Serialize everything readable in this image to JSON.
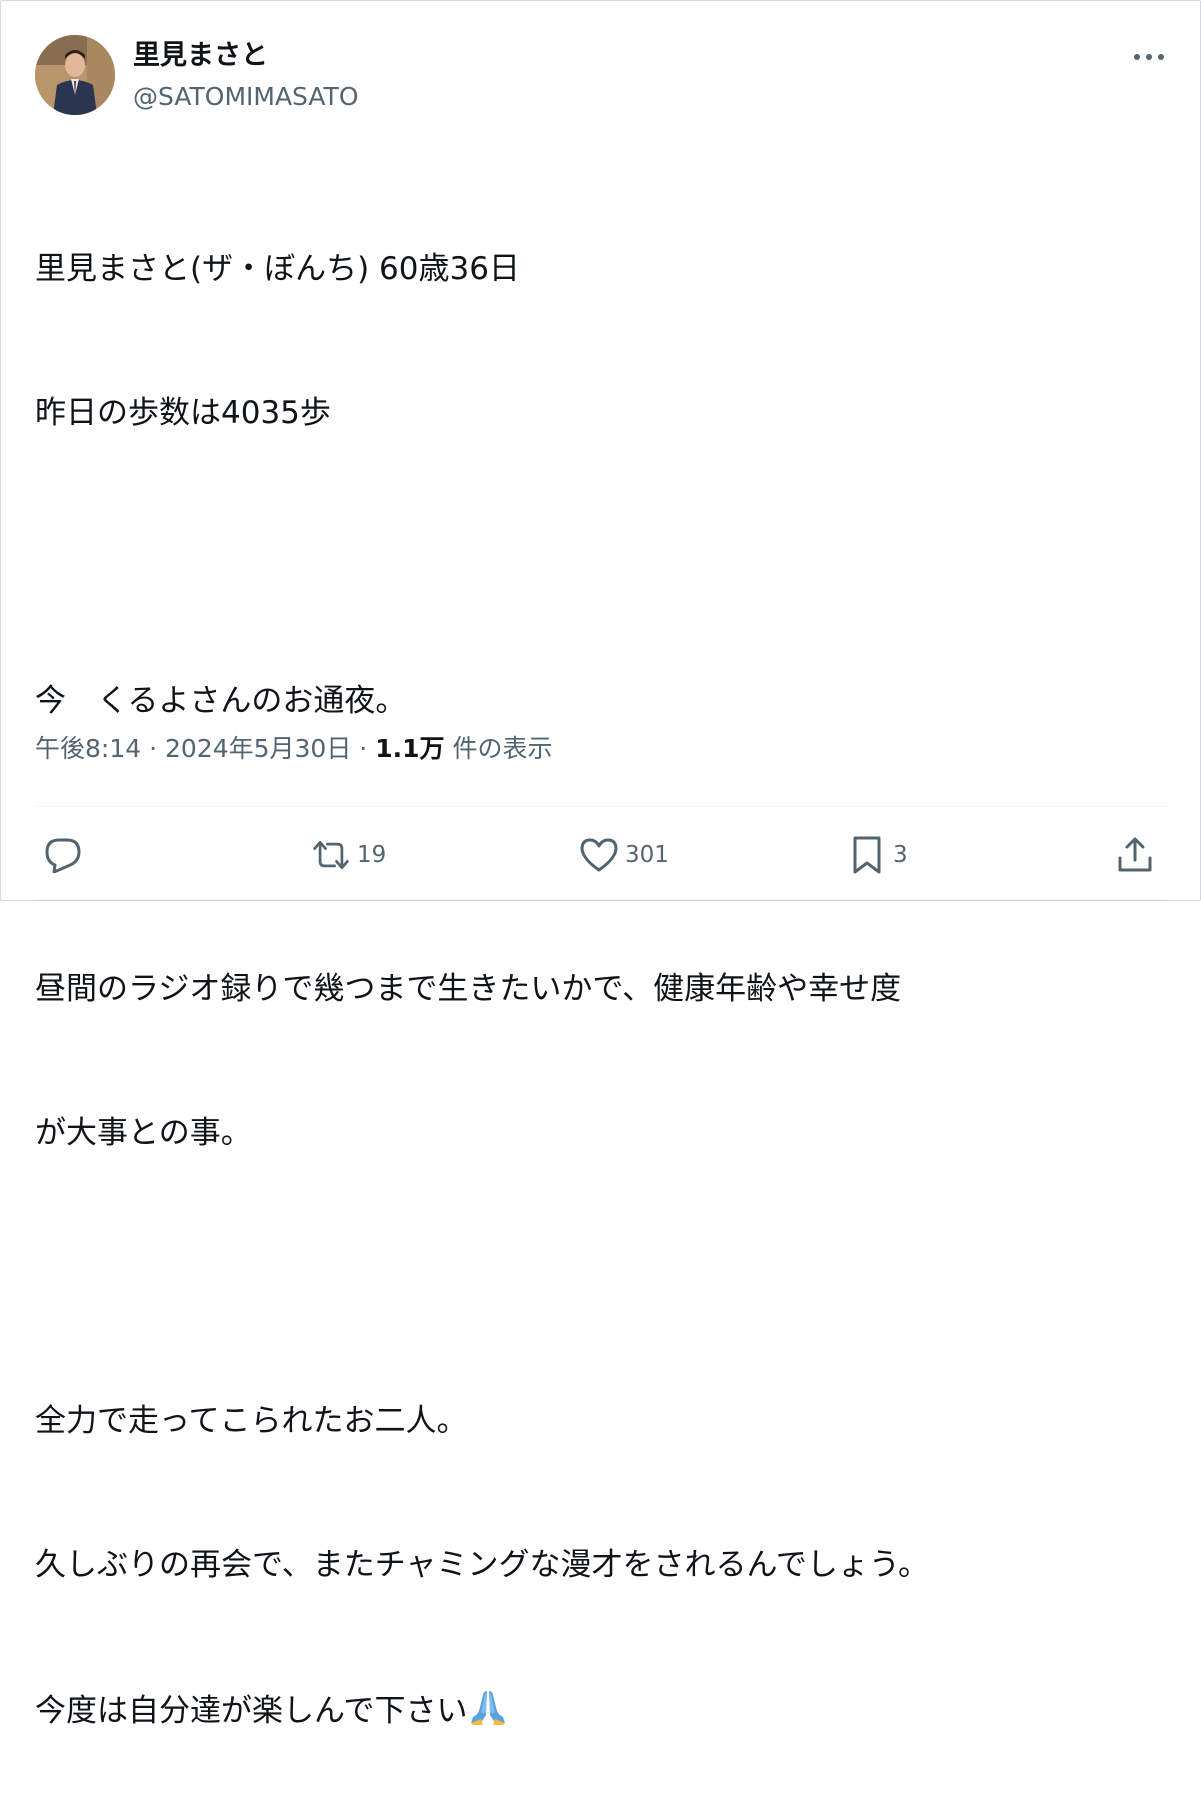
{
  "author": {
    "display_name": "里見まさと",
    "handle": "@SATOMIMASATO",
    "avatar_icon": "avatar-photo"
  },
  "post": {
    "lines": [
      "里見まさと(ザ・ぼんち) 60歳36日",
      "昨日の歩数は4035歩",
      "",
      "今　くるよさんのお通夜。",
      "",
      "昼間のラジオ録りで幾つまで生きたいかで、健康年齢や幸せ度",
      "が大事との事。",
      "",
      "全力で走ってこられたお二人。",
      "久しぶりの再会で、またチャミングな漫才をされるんでしょう。",
      "今度は自分達が楽しんで下さい"
    ],
    "emoji": "folded-hands-emoji"
  },
  "meta": {
    "time": "午後8:14",
    "separator1": "·",
    "date": "2024年5月30日",
    "separator2": "·",
    "views_count": "1.1万",
    "views_label": "件の表示"
  },
  "actions": {
    "reply_count": "",
    "retweet_count": "19",
    "like_count": "301",
    "bookmark_count": "3"
  },
  "colors": {
    "text": "#0f1419",
    "secondary": "#536471",
    "border": "#cfd9de",
    "divider": "#eff3f4"
  }
}
